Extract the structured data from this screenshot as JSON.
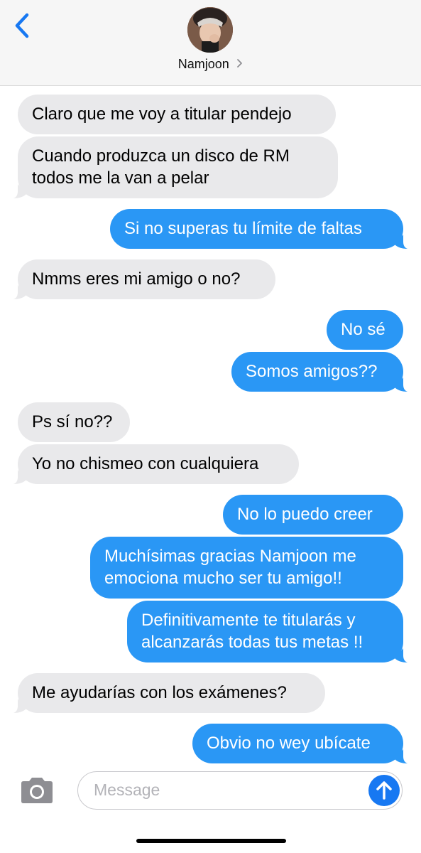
{
  "header": {
    "contact_name": "Namjoon",
    "back_icon": "chevron-left-icon",
    "chevron_icon": "chevron-right-icon"
  },
  "messages": [
    {
      "direction": "incoming",
      "text": "Claro que me voy a titular pendejo"
    },
    {
      "direction": "incoming",
      "text": "Cuando produzca un disco de RM\ntodos me la van a pelar"
    },
    {
      "direction": "outgoing",
      "text": "Si no superas tu límite de faltas"
    },
    {
      "direction": "incoming",
      "text": "Nmms eres mi amigo o no?"
    },
    {
      "direction": "outgoing",
      "text": "No sé"
    },
    {
      "direction": "outgoing",
      "text": "Somos amigos??"
    },
    {
      "direction": "incoming",
      "text": "Ps sí no??"
    },
    {
      "direction": "incoming",
      "text": "Yo no chismeo con cualquiera"
    },
    {
      "direction": "outgoing",
      "text": "No lo puedo creer"
    },
    {
      "direction": "outgoing",
      "text": "Muchísimas gracias Namjoon me\nemociona mucho ser tu amigo!!"
    },
    {
      "direction": "outgoing",
      "text": "Definitivamente te titularás y\nalcanzarás todas tus metas !!"
    },
    {
      "direction": "incoming",
      "text": "Me ayudarías con los exámenes?"
    },
    {
      "direction": "outgoing",
      "text": "Obvio no wey ubícate"
    }
  ],
  "composer": {
    "placeholder": "Message",
    "camera_icon": "camera-icon",
    "send_icon": "send-arrow-up-icon"
  },
  "colors": {
    "outgoing_bubble": "#2a97f5",
    "incoming_bubble": "#e9e9eb",
    "accent": "#1778f2"
  }
}
